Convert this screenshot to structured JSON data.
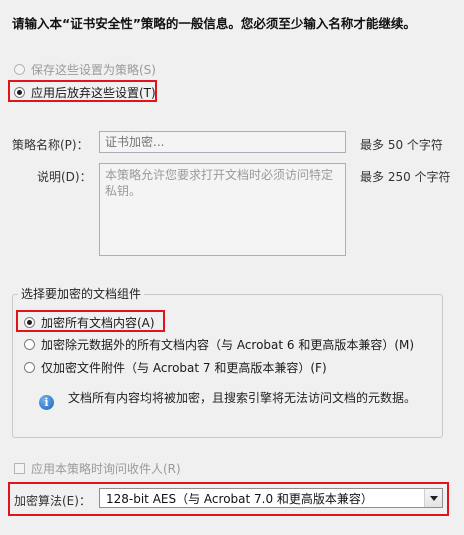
{
  "heading": "请输入本“证书安全性”策略的一般信息。您必须至少输入名称才能继续。",
  "options": {
    "save_label": "保存这些设置为策略(S)",
    "discard_label": "应用后放弃这些设置(T)"
  },
  "policy_name": {
    "label": "策略名称(P)：",
    "placeholder": "证书加密...",
    "hint": "最多 50 个字符"
  },
  "description": {
    "label": "说明(D)：",
    "value": "本策略允许您要求打开文档时必须访问特定私钥。",
    "hint": "最多 250 个字符"
  },
  "components": {
    "title": "选择要加密的文档组件",
    "option_all": "加密所有文档内容(A)",
    "option_except_metadata": "加密除元数据外的所有文档内容（与 Acrobat 6 和更高版本兼容）(M)",
    "option_attachments": "仅加密文件附件（与 Acrobat 7 和更高版本兼容）(F)",
    "info_text": "文档所有内容均将被加密，且搜索引擎将无法访问文档的元数据。"
  },
  "ask_recipients_label": "应用本策略时询问收件人(R)",
  "algorithm": {
    "label": "加密算法(E)：",
    "value": "128-bit AES（与 Acrobat 7.0 和更高版本兼容）"
  }
}
